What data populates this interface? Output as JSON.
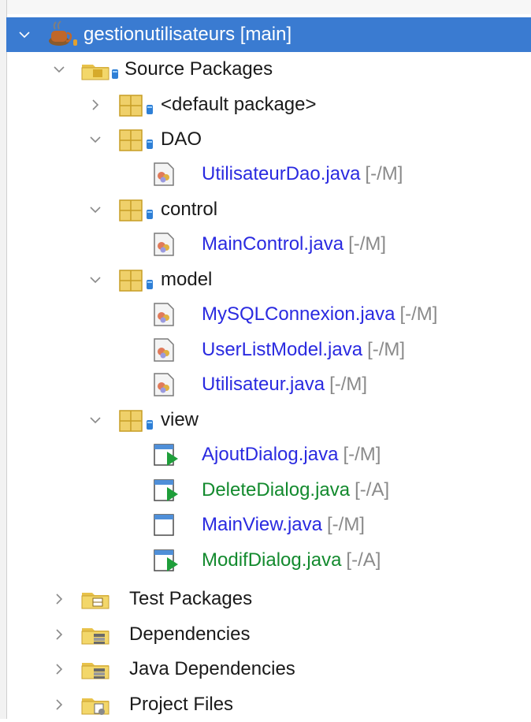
{
  "project": {
    "name": "gestionutilisateurs [main]",
    "source_packages": "Source Packages",
    "packages": [
      {
        "name": "<default package>",
        "files": []
      },
      {
        "name": "DAO",
        "files": [
          {
            "name": "UtilisateurDao.java",
            "status": "[-/M]"
          }
        ]
      },
      {
        "name": "control",
        "files": [
          {
            "name": "MainControl.java",
            "status": "[-/M]"
          }
        ]
      },
      {
        "name": "model",
        "files": [
          {
            "name": "MySQLConnexion.java",
            "status": "[-/M]"
          },
          {
            "name": "UserListModel.java",
            "status": "[-/M]"
          },
          {
            "name": "Utilisateur.java",
            "status": "[-/M]"
          }
        ]
      },
      {
        "name": "view",
        "files": [
          {
            "name": "AjoutDialog.java",
            "status": "[-/M]"
          },
          {
            "name": "DeleteDialog.java",
            "status": "[-/A]"
          },
          {
            "name": "MainView.java",
            "status": "[-/M]"
          },
          {
            "name": "ModifDialog.java",
            "status": "[-/A]"
          }
        ]
      }
    ],
    "nodes": {
      "test_packages": "Test Packages",
      "dependencies": "Dependencies",
      "java_dependencies": "Java Dependencies",
      "project_files": "Project Files"
    }
  },
  "colors": {
    "selection": "#3a7bd1",
    "modified": "#2a2ae0",
    "added": "#138a2e",
    "status": "#8a8a8a"
  },
  "icons": {
    "project": "coffee-cup-icon",
    "package": "package-icon",
    "java_class": "java-class-icon",
    "form": "form-icon",
    "folder": "folder-icon"
  }
}
